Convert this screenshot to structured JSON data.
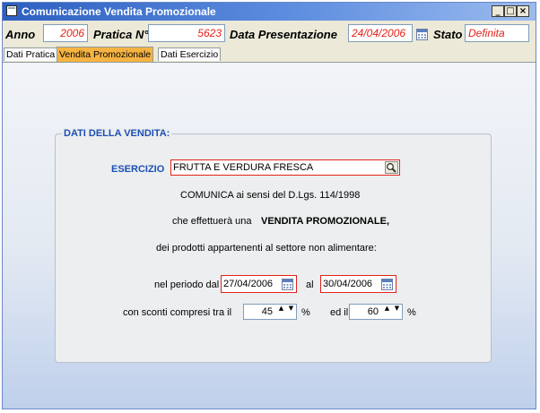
{
  "window": {
    "title": "Comunicazione Vendita Promozionale",
    "buttons": [
      "_",
      "□",
      "×"
    ]
  },
  "header": {
    "anno_label": "Anno",
    "anno_value": "2006",
    "pratica_label": "Pratica N°",
    "pratica_value": "5623",
    "data_label": "Data Presentazione",
    "data_value": "24/04/2006",
    "stato_label": "Stato",
    "stato_value": "Definita"
  },
  "tabs": [
    {
      "label": "Dati Pratica",
      "active": false
    },
    {
      "label": "Vendita Promozionale",
      "active": true
    },
    {
      "label": "Dati Esercizio",
      "active": false
    }
  ],
  "form": {
    "group_title": "DATI DELLA VENDITA:",
    "esercizio_label": "ESERCIZIO",
    "esercizio_value": "FRUTTA E VERDURA FRESCA",
    "line1": "COMUNICA ai sensi del D.Lgs. 114/1998",
    "line2_prefix": "che effettuerà una",
    "line2_bold": "VENDITA PROMOZIONALE,",
    "line3": "dei prodotti appartenenti al settore non alimentare:",
    "periodo_label": "nel periodo dal",
    "periodo_from": "27/04/2006",
    "periodo_al": "al",
    "periodo_to": "30/04/2006",
    "sconti_label": "con sconti compresi tra il",
    "sconto_min": "45",
    "percent1": "%",
    "ed_il": "ed il",
    "sconto_max": "60",
    "percent2": "%"
  },
  "colors": {
    "accent": "#1b4fb5",
    "required": "#e2231a",
    "active_tab": "#f5b342"
  },
  "icons": {
    "calendar": "calendar-icon",
    "search": "search-icon",
    "spin_up": "spin-up-icon",
    "spin_down": "spin-down-icon"
  }
}
